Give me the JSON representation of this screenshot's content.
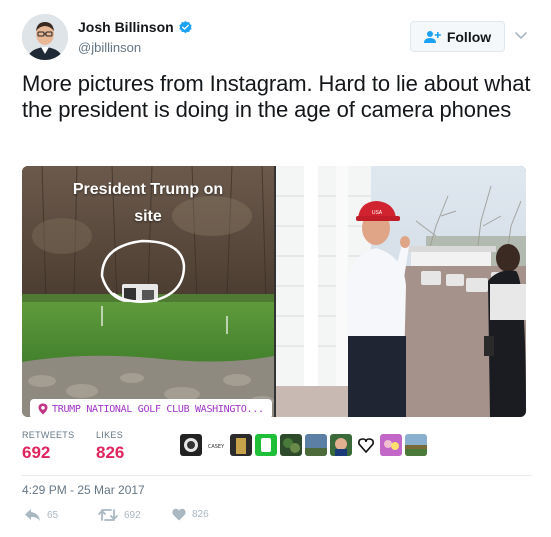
{
  "author": {
    "name": "Josh Billinson",
    "handle": "@jbillinson",
    "verified": true
  },
  "follow_button": {
    "label": "Follow",
    "icon": "add-user-icon"
  },
  "tweet": {
    "text": "More pictures from Instagram. Hard to lie about what the president is doing in the age of camera phones",
    "timestamp": "4:29 PM - 25 Mar 2017"
  },
  "media": {
    "left_caption_line1": "President Trump on",
    "left_caption_line2": "site",
    "location_sticker": "TRUMP NATIONAL GOLF CLUB WASHINGTO...",
    "hat_text": "USA"
  },
  "stats": {
    "retweets_label": "RETWEETS",
    "retweets_value": "692",
    "likes_label": "LIKES",
    "likes_value": "826",
    "liker_badge_text": "CASEY"
  },
  "actions": {
    "reply_count": "65",
    "retweet_count": "692",
    "like_count": "826"
  },
  "colors": {
    "accent": "#1da1f2",
    "likes": "#e0245e",
    "muted": "#657786",
    "sticker": "#a134c8"
  }
}
